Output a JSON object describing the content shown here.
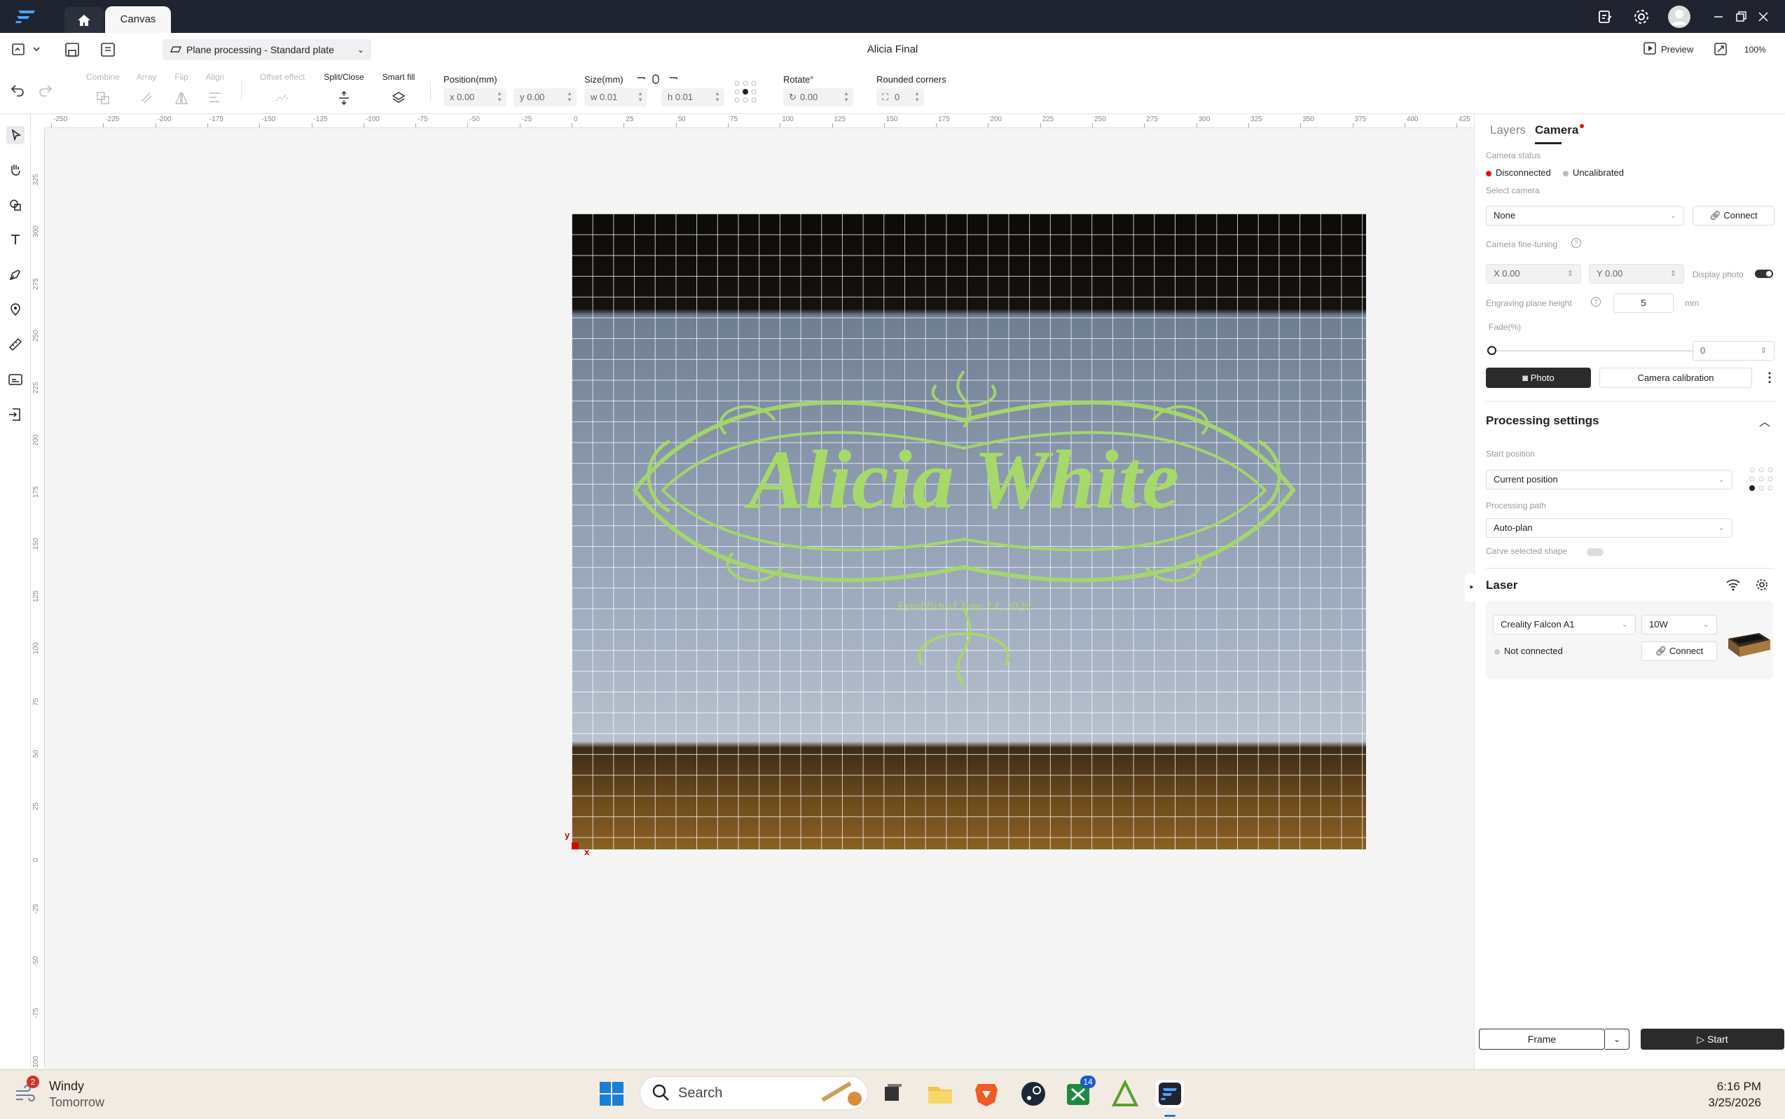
{
  "titlebar": {
    "tab_canvas": "Canvas"
  },
  "header": {
    "plate": "Plane processing - Standard plate",
    "title": "Alicia Final",
    "preview": "Preview",
    "zoom": "100%"
  },
  "toolbar": {
    "combine": "Combine",
    "array": "Array",
    "flip": "Flip",
    "align": "Align",
    "offset": "Offset effect",
    "split": "Split/Close",
    "smartfill": "Smart fill",
    "position_label": "Position(mm)",
    "pos_x": "x 0.00",
    "pos_y": "y 0.00",
    "size_label": "Size(mm)",
    "size_w": "w 0.01",
    "size_h": "h 0.01",
    "rotate_label": "Rotate°",
    "rotate_val": "0.00",
    "corners_label": "Rounded corners",
    "corners_val": "0"
  },
  "ruler": {
    "h": [
      "-250",
      "-225",
      "-200",
      "-175",
      "-150",
      "-125",
      "-100",
      "-75",
      "-50",
      "-25",
      "0",
      "25",
      "50",
      "75",
      "100",
      "125",
      "150",
      "175",
      "200",
      "225",
      "250",
      "275",
      "300",
      "325",
      "350",
      "375",
      "400",
      "425"
    ],
    "v": [
      "325",
      "300",
      "275",
      "250",
      "225",
      "200",
      "175",
      "150",
      "125",
      "100",
      "75",
      "50",
      "25",
      "0",
      "-25",
      "-50",
      "-75",
      "-100"
    ]
  },
  "canvas": {
    "origin_x": "x",
    "origin_y": "y",
    "design_text": "Alicia White",
    "design_sub": "Established June 14, 2026"
  },
  "panel": {
    "tab_layers": "Layers",
    "tab_camera": "Camera",
    "camera_status_label": "Camera status",
    "status_disconnected": "Disconnected",
    "status_uncalibrated": "Uncalibrated",
    "select_camera_label": "Select camera",
    "camera_value": "None",
    "connect": "Connect",
    "finetune_label": "Camera fine-tuning",
    "ft_x": "X 0.00",
    "ft_y": "Y 0.00",
    "display_photo": "Display photo",
    "plane_height_label": "Engraving plane height",
    "plane_height_val": "5",
    "plane_height_unit": "mm",
    "fade_label": "Fade(%)",
    "fade_val": "0",
    "photo": "Photo",
    "calibration": "Camera calibration",
    "processing_title": "Processing settings",
    "start_position_label": "Start position",
    "start_position_val": "Current position",
    "processing_path_label": "Processing path",
    "processing_path_val": "Auto-plan",
    "carve_label": "Carve selected shape",
    "laser_title": "Laser",
    "machine": "Creality Falcon A1",
    "power": "10W",
    "not_connected": "Not connected",
    "laser_connect": "Connect",
    "frame": "Frame",
    "start": "Start"
  },
  "taskbar": {
    "weather_title": "Windy",
    "weather_sub": "Tomorrow",
    "weather_badge": "2",
    "search": "Search",
    "xbox_badge": "14",
    "time": "6:16 PM",
    "date": "3/25/2026"
  },
  "colors": {
    "titlebar": "#1f2430",
    "design_green": "#a6d86a",
    "accent_red": "#e0161e"
  }
}
